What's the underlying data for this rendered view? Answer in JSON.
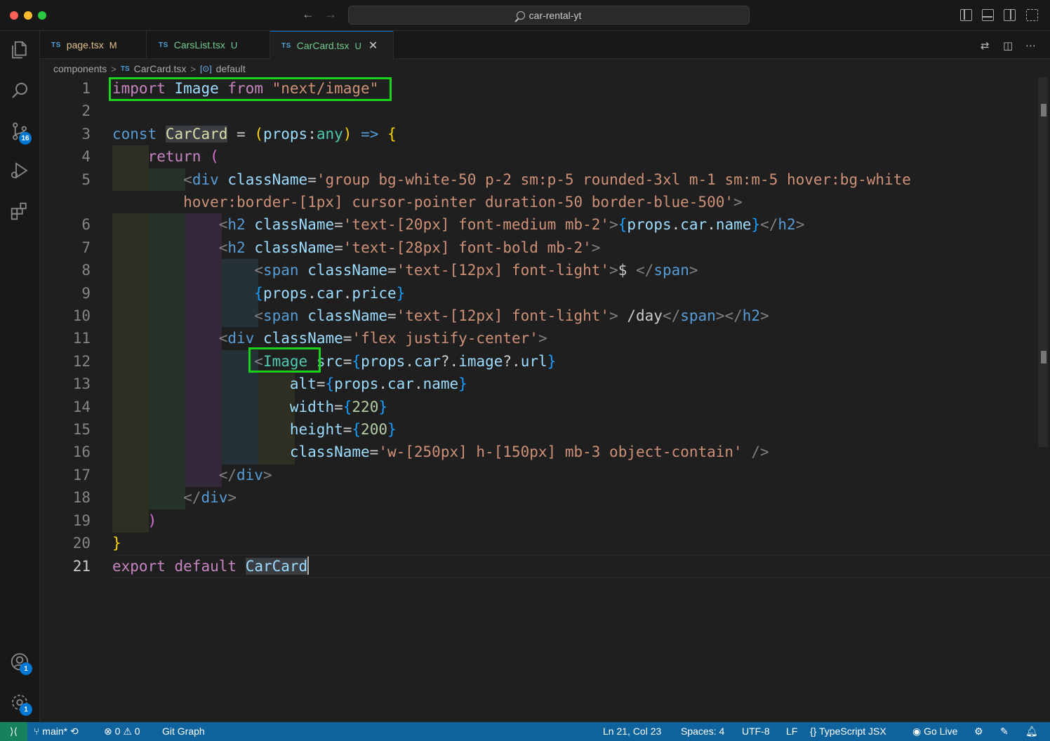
{
  "window": {
    "search_title": "car-rental-yt"
  },
  "activity_bar": {
    "source_control_badge": "16",
    "accounts_badge": "1",
    "manage_badge": "1"
  },
  "tabs": [
    {
      "lang": "TS",
      "name": "page.tsx",
      "status": "M"
    },
    {
      "lang": "TS",
      "name": "CarsList.tsx",
      "status": "U"
    },
    {
      "lang": "TS",
      "name": "CarCard.tsx",
      "status": "U",
      "active": true
    }
  ],
  "breadcrumb": {
    "folder": "components",
    "lang": "TS",
    "file": "CarCard.tsx",
    "symbol": "default"
  },
  "editor": {
    "line_numbers": [
      "1",
      "2",
      "3",
      "4",
      "5",
      "6",
      "7",
      "8",
      "9",
      "10",
      "11",
      "12",
      "13",
      "14",
      "15",
      "16",
      "17",
      "18",
      "19",
      "20",
      "21"
    ],
    "current_line": "21"
  },
  "status_bar": {
    "branch": "main*",
    "errors": "0",
    "warnings": "0",
    "git_graph": "Git Graph",
    "position": "Ln 21, Col 23",
    "spaces": "Spaces: 4",
    "encoding": "UTF-8",
    "eol": "LF",
    "language": "TypeScript JSX",
    "go_live": "Go Live"
  },
  "colors": {
    "accent": "#0078d4",
    "status_bar": "#0e639c",
    "highlight_box": "#1ad31a"
  }
}
